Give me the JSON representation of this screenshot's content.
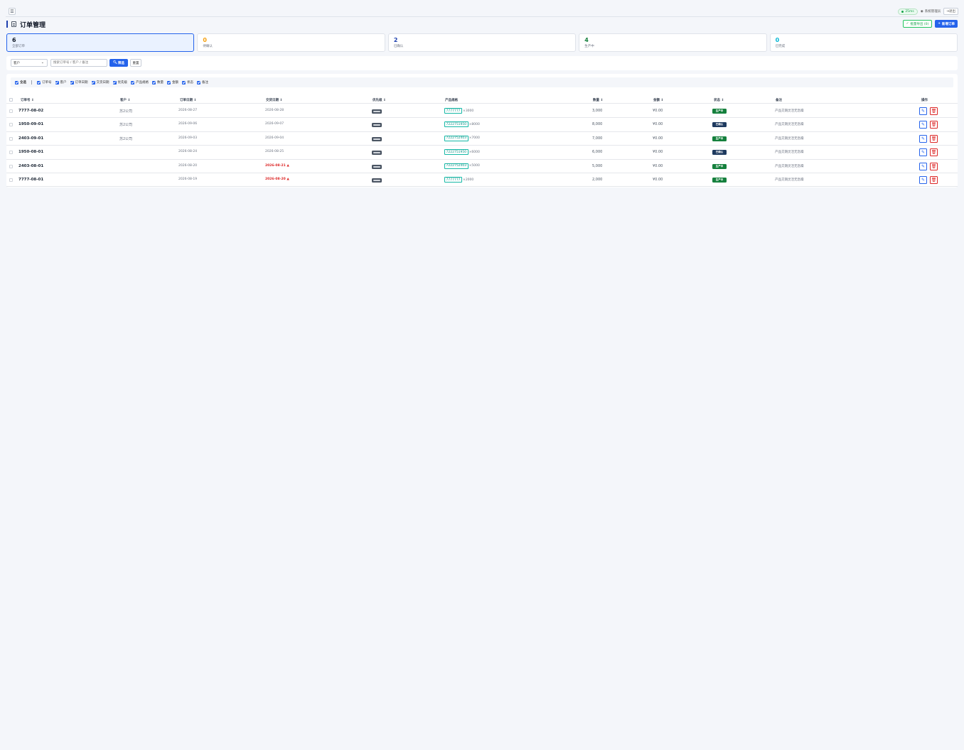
{
  "topbar": {
    "ping": "25ms",
    "user": "系统管理员",
    "logout": "退出"
  },
  "page": {
    "title": "订单管理",
    "batch_button": "批量导出 (0)",
    "new_button": "新增订单"
  },
  "stats": [
    {
      "value": "6",
      "label": "全部订单",
      "color": "#111827"
    },
    {
      "value": "0",
      "label": "待确认",
      "color": "#f59e0b"
    },
    {
      "value": "2",
      "label": "已确认",
      "color": "#1e40af"
    },
    {
      "value": "4",
      "label": "生产中",
      "color": "#15803d"
    },
    {
      "value": "0",
      "label": "已完成",
      "color": "#06b6d4"
    }
  ],
  "filter": {
    "select_value": "客户",
    "search_placeholder": "搜索订单号 / 客户 / 备注",
    "filter_button": "筛选",
    "reset_button": "重置"
  },
  "column_toggles": {
    "all_label": "全选",
    "items": [
      "订单号",
      "客户",
      "订单日期",
      "交货日期",
      "优先级",
      "产品规格",
      "数量",
      "金额",
      "状态",
      "备注"
    ]
  },
  "table": {
    "headers": [
      "订单号 ↕",
      "客户 ↕",
      "订单日期 ↕",
      "交货日期 ↕",
      "优先级 ↕",
      "产品规格",
      "数量 ↕",
      "金额 ↕",
      "状态 ↕",
      "备注",
      "操作"
    ],
    "rows": [
      {
        "order_no": "7777-08-02",
        "customer": "苏2公司",
        "order_date": "2026-08-27",
        "delivery_date": "2026-08-28",
        "overdue": false,
        "spec_code": "7777777",
        "spec_qty": "×3000",
        "qty": "3,000",
        "amount": "¥0.00",
        "status": "生产中",
        "status_type": "prod",
        "note": "产品交期灵活无急躁"
      },
      {
        "order_no": "1950-09-01",
        "customer": "苏2公司",
        "order_date": "2026-09-06",
        "delivery_date": "2026-09-07",
        "overdue": false,
        "spec_code": "7222751950",
        "spec_qty": "×8000",
        "qty": "8,000",
        "amount": "¥0.00",
        "status": "已确认",
        "status_type": "conf",
        "note": "产品交期灵活无急躁"
      },
      {
        "order_no": "2403-09-01",
        "customer": "苏2公司",
        "order_date": "2026-09-03",
        "delivery_date": "2026-09-04",
        "overdue": false,
        "spec_code": "7222752403",
        "spec_qty": "×7000",
        "qty": "7,000",
        "amount": "¥0.00",
        "status": "生产中",
        "status_type": "prod",
        "note": "产品交期灵活无急躁"
      },
      {
        "order_no": "1950-08-01",
        "customer": "",
        "order_date": "2026-08-24",
        "delivery_date": "2026-08-25",
        "overdue": false,
        "spec_code": "7222751950",
        "spec_qty": "×6000",
        "qty": "6,000",
        "amount": "¥0.00",
        "status": "已确认",
        "status_type": "conf",
        "note": "产品交期灵活无急躁"
      },
      {
        "order_no": "2403-08-01",
        "customer": "",
        "order_date": "2026-08-20",
        "delivery_date": "2026-08-21 ▲",
        "overdue": true,
        "spec_code": "7222752403",
        "spec_qty": "×5000",
        "qty": "5,000",
        "amount": "¥0.00",
        "status": "生产中",
        "status_type": "prod",
        "note": "产品交期灵活无急躁"
      },
      {
        "order_no": "7777-08-01",
        "customer": "",
        "order_date": "2026-08-19",
        "delivery_date": "2026-08-20 ▲",
        "overdue": true,
        "spec_code": "7777777",
        "spec_qty": "×2000",
        "qty": "2,000",
        "amount": "¥0.00",
        "status": "生产中",
        "status_type": "prod",
        "note": "产品交期灵活无急躁"
      }
    ]
  }
}
